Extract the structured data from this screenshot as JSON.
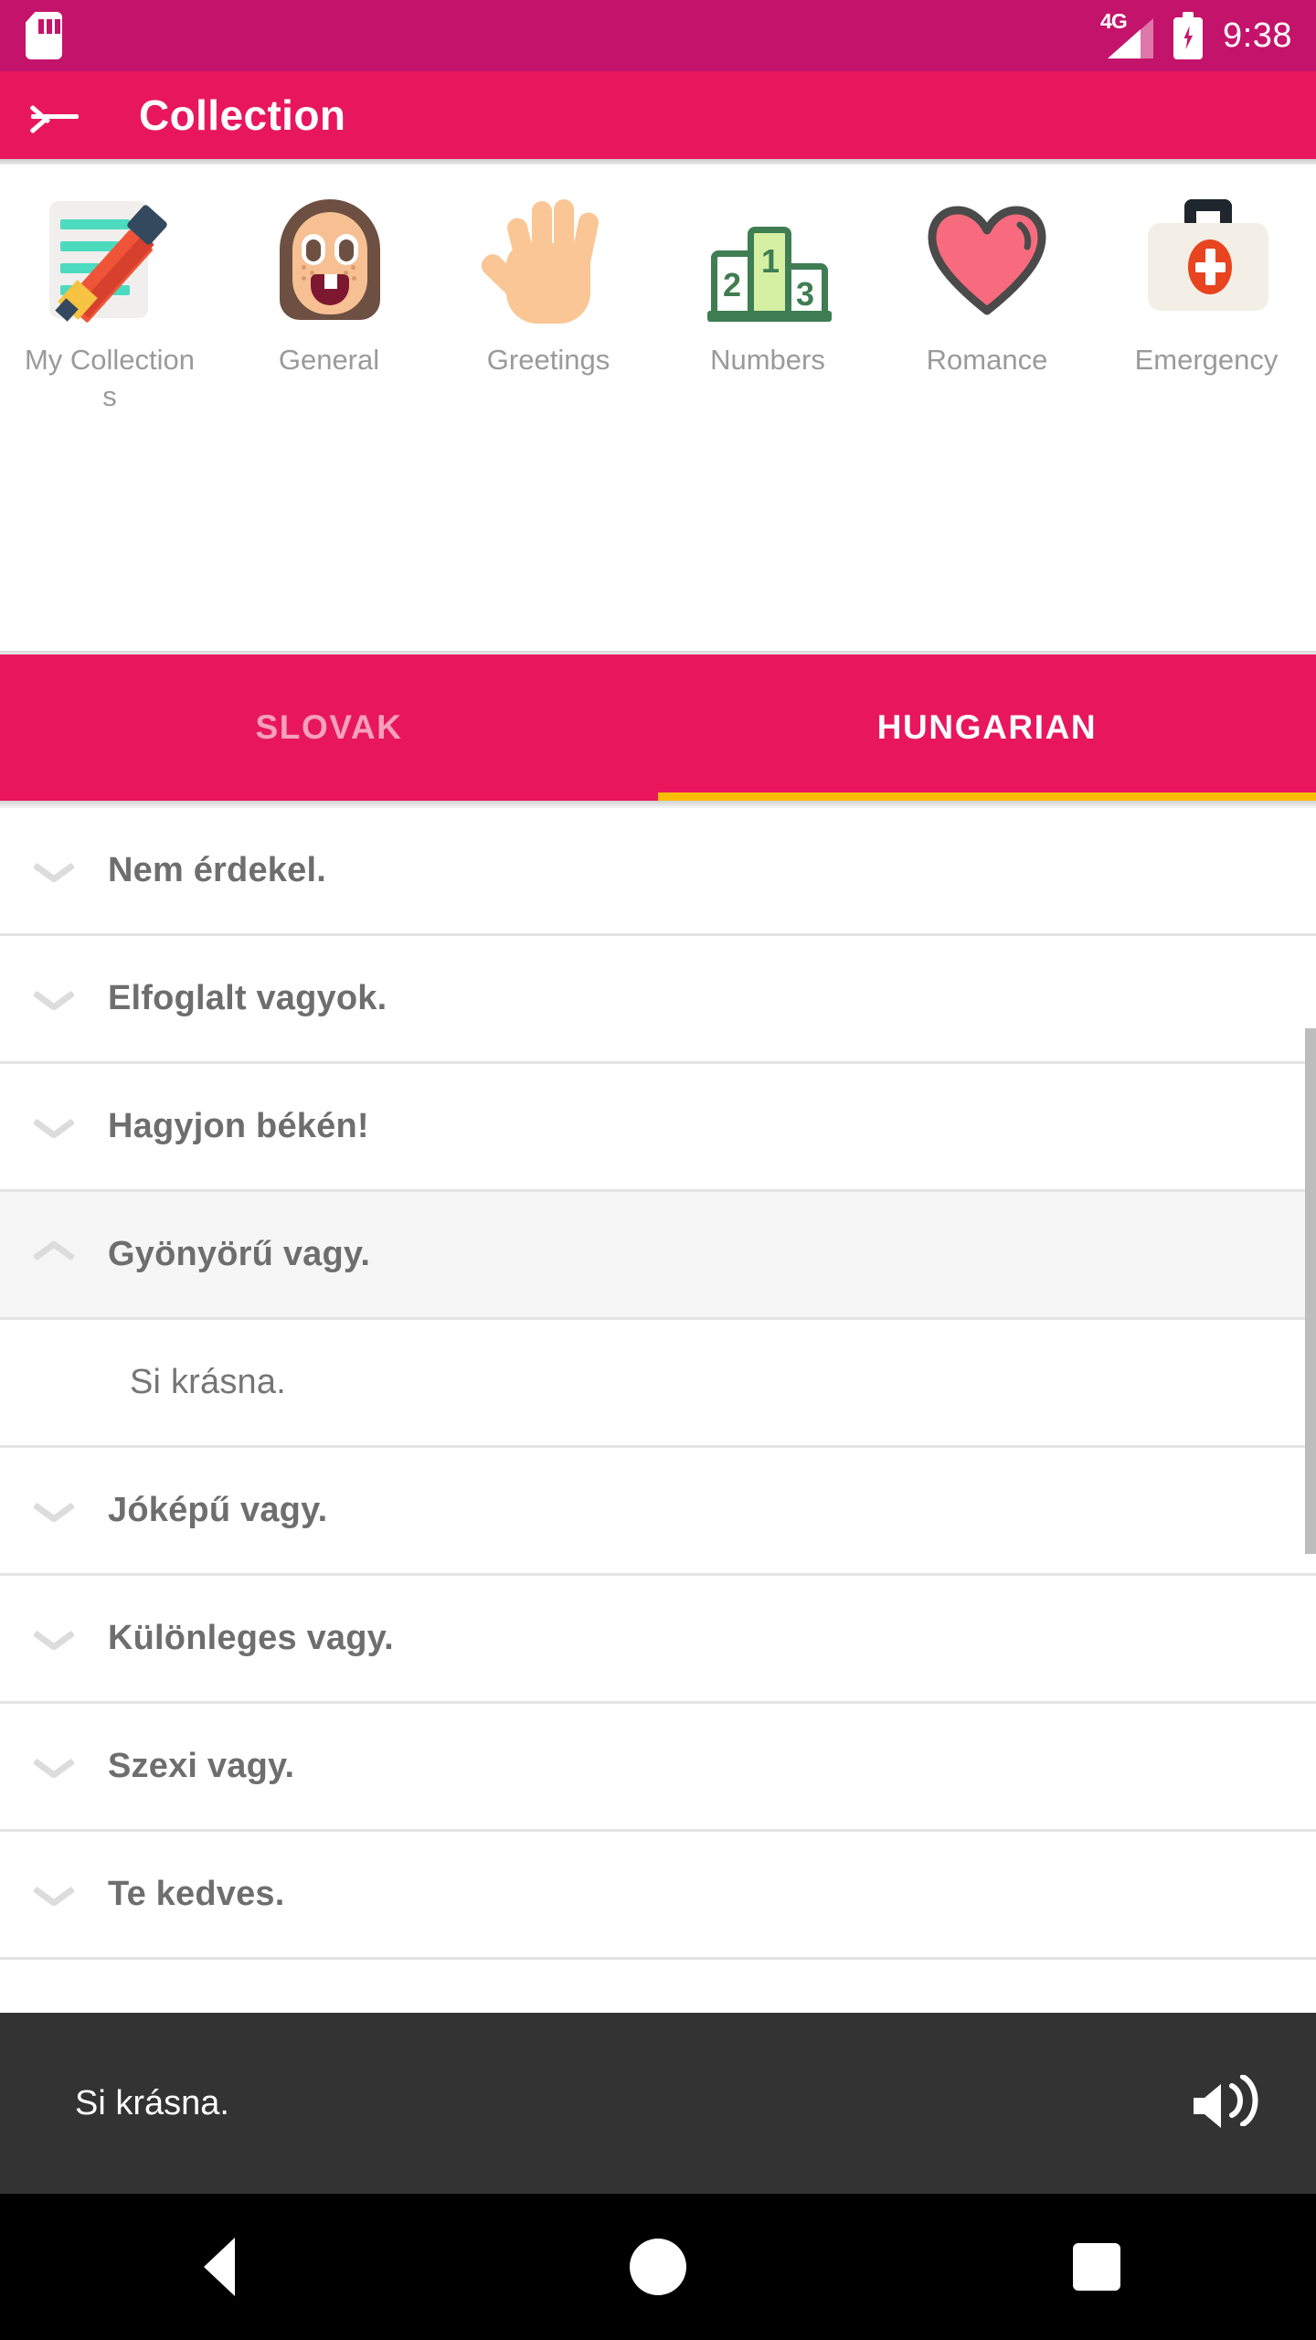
{
  "status_bar": {
    "sd_icon": "sd-card-icon",
    "network_label": "4G",
    "signal_icon": "signal-bars-icon",
    "battery_icon": "battery-charging-icon",
    "time": "9:38"
  },
  "app_bar": {
    "back_icon": "back-arrow-icon",
    "title": "Collection"
  },
  "categories": {
    "expand_icon": "chevron-down-icon",
    "items": [
      {
        "label": "My Collections",
        "icon": "notepad-pencil-icon"
      },
      {
        "label": "General",
        "icon": "face-icon"
      },
      {
        "label": "Greetings",
        "icon": "raised-hand-icon"
      },
      {
        "label": "Numbers",
        "icon": "podium-123-icon"
      },
      {
        "label": "Romance",
        "icon": "heart-icon"
      },
      {
        "label": "Emergency",
        "icon": "first-aid-kit-icon"
      }
    ]
  },
  "tabs": {
    "items": [
      {
        "label": "SLOVAK",
        "active": false
      },
      {
        "label": "HUNGARIAN",
        "active": true
      }
    ],
    "indicator_color": "#fbbc05"
  },
  "phrase_list": {
    "rows": [
      {
        "text": "Nem érdekel.",
        "state": "collapsed",
        "icon": "chevron-down-icon"
      },
      {
        "text": "Elfoglalt vagyok.",
        "state": "collapsed",
        "icon": "chevron-down-icon"
      },
      {
        "text": "Hagyjon békén!",
        "state": "collapsed",
        "icon": "chevron-down-icon"
      },
      {
        "text": "Gyönyörű vagy.",
        "state": "expanded",
        "icon": "chevron-up-icon"
      },
      {
        "text": "Si krásna.",
        "state": "translation",
        "icon": ""
      },
      {
        "text": "Jóképű vagy.",
        "state": "collapsed",
        "icon": "chevron-down-icon"
      },
      {
        "text": "Különleges vagy.",
        "state": "collapsed",
        "icon": "chevron-down-icon"
      },
      {
        "text": "Szexi vagy.",
        "state": "collapsed",
        "icon": "chevron-down-icon"
      },
      {
        "text": "Te kedves.",
        "state": "collapsed",
        "icon": "chevron-down-icon"
      }
    ],
    "scrollbar": "vertical-scrollbar"
  },
  "player": {
    "text": "Si krásna.",
    "speaker_icon": "speaker-volume-icon"
  },
  "nav_bar": {
    "back": "nav-back-icon",
    "home": "nav-home-icon",
    "recents": "nav-recents-icon"
  },
  "colors": {
    "status_bar": "#c4136b",
    "app_bar": "#e8175d",
    "tab_bar": "#e8175d",
    "tab_indicator": "#fbbc05",
    "player_bg": "#333333",
    "nav_bg": "#000000"
  }
}
